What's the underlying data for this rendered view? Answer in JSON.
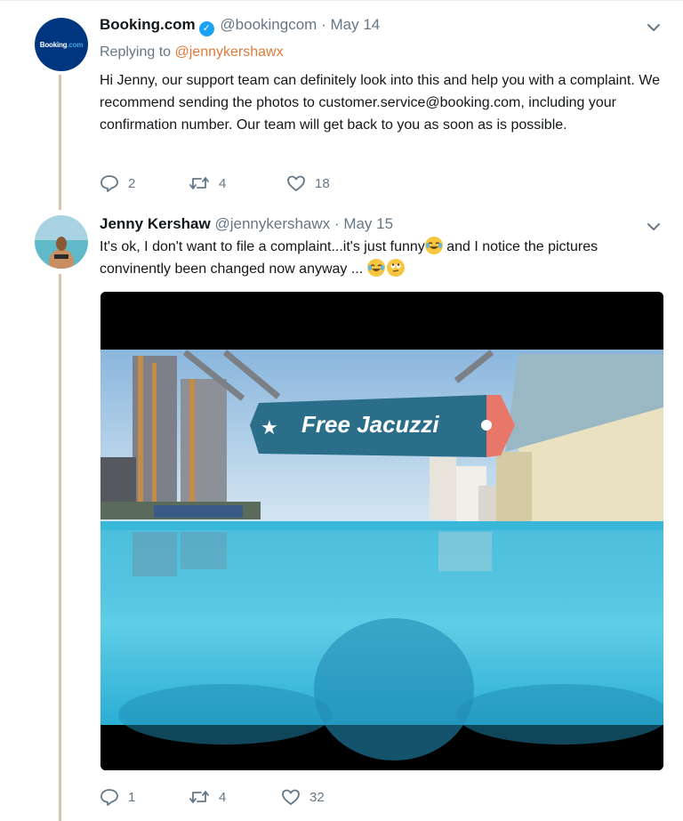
{
  "tweet1": {
    "name": "Booking.com",
    "handle": "@bookingcom",
    "separator": "·",
    "date": "May 14",
    "replying_prefix": "Replying to ",
    "replying_mention": "@jennykershawx",
    "text": "Hi Jenny, our support team can definitely look into this and help you with a complaint. We recommend sending the photos to customer.service@booking.com, including your confirmation number. Our team will get back to you as soon as is possible.",
    "avatar_text_a": "Booking",
    "avatar_text_b": ".com",
    "replies": "2",
    "retweets": "4",
    "likes": "18"
  },
  "tweet2": {
    "name": "Jenny Kershaw",
    "handle": "@jennykershawx",
    "separator": "·",
    "date": "May 15",
    "text_part1": "It's ok, I don't want to file a complaint...it's just funny",
    "text_part2": " and I notice the pictures convinently been changed now anyway ... ",
    "image_banner": "Free Jacuzzi",
    "image_star": "★",
    "replies": "1",
    "retweets": "4",
    "likes": "32"
  },
  "icons": [
    "verified-icon",
    "chevron-down-icon",
    "reply-icon",
    "retweet-icon",
    "like-icon",
    "laughing-emoji",
    "eye-roll-emoji",
    "star-icon"
  ],
  "colors": {
    "link": "#e0793a",
    "secondary": "#657786",
    "thread": "#d9c3a9",
    "verified": "#1da1f2",
    "banner": "#2a6e8a",
    "banner_tag": "#e8776a"
  }
}
